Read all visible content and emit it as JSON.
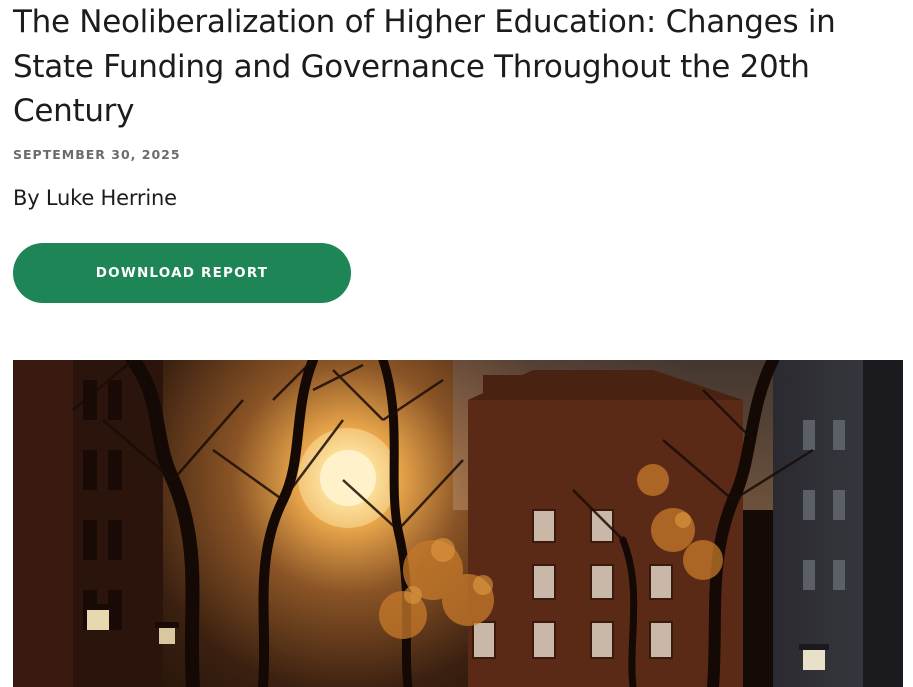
{
  "article": {
    "title": "The Neoliberalization of Higher Education: Changes in State Funding and Governance Throughout the 20th Century",
    "date": "SEPTEMBER 30, 2025",
    "byline": "By Luke Herrine",
    "download_label": "DOWNLOAD REPORT"
  },
  "hero_image": {
    "subject": "campus-buildings-at-sunset-photo"
  },
  "colors": {
    "accent": "#1e8656",
    "title_text": "#1c1c1c",
    "date_text": "#6b6b6b"
  }
}
